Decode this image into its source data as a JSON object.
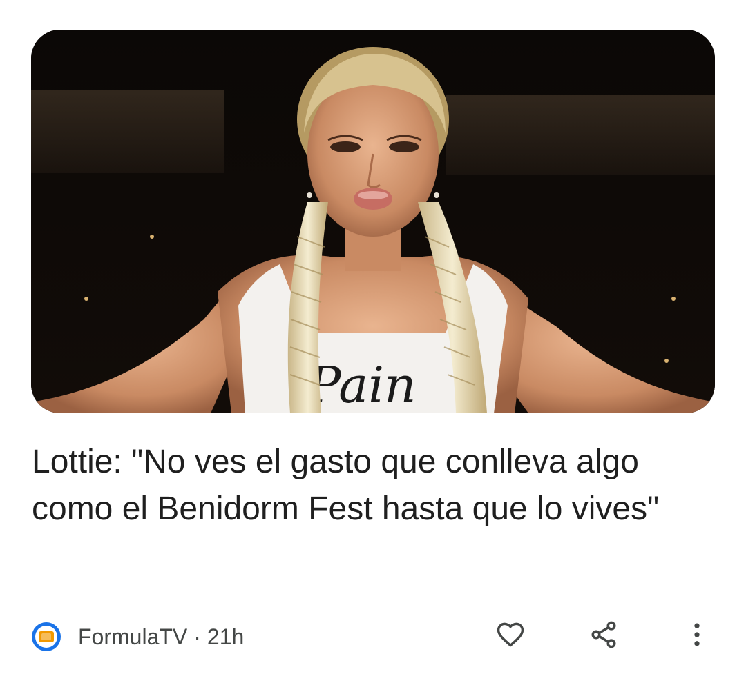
{
  "article": {
    "image": {
      "shirt_text": "Pain"
    },
    "headline": "Lottie: \"No ves el gasto que conlleva algo como el Benidorm Fest hasta que lo vives\"",
    "source": {
      "name": "FormulaTV",
      "logo_icon": "formulatv-logo-icon",
      "logo_colors": [
        "#1a73e8",
        "#f29900",
        "#ffffff"
      ]
    },
    "separator": "·",
    "time": "21h",
    "actions": {
      "like_icon": "heart-outline-icon",
      "share_icon": "share-icon",
      "more_icon": "more-vert-icon"
    }
  }
}
